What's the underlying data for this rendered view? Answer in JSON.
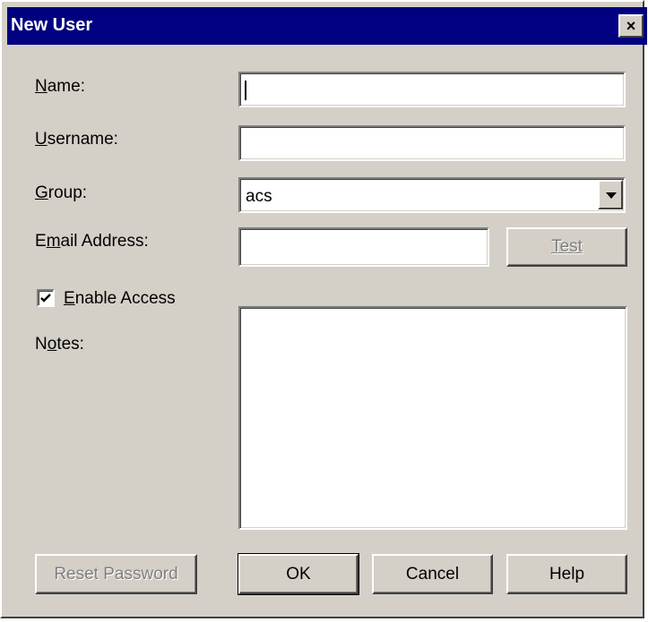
{
  "window": {
    "title": "New User",
    "close_icon": "×"
  },
  "form": {
    "name_label": "Name:",
    "name_value": "",
    "username_label": "Username:",
    "username_value": "",
    "group_label": "Group:",
    "group_value": "acs",
    "email_label": "Email Address:",
    "email_value": "",
    "test_button": "Test",
    "enable_access_label": "Enable Access",
    "enable_access_checked": true,
    "notes_label": "Notes:",
    "notes_value": ""
  },
  "buttons": {
    "reset_password": "Reset Password",
    "ok": "OK",
    "cancel": "Cancel",
    "help": "Help"
  },
  "colors": {
    "titlebar": "#000080",
    "face": "#d4d0c8"
  }
}
